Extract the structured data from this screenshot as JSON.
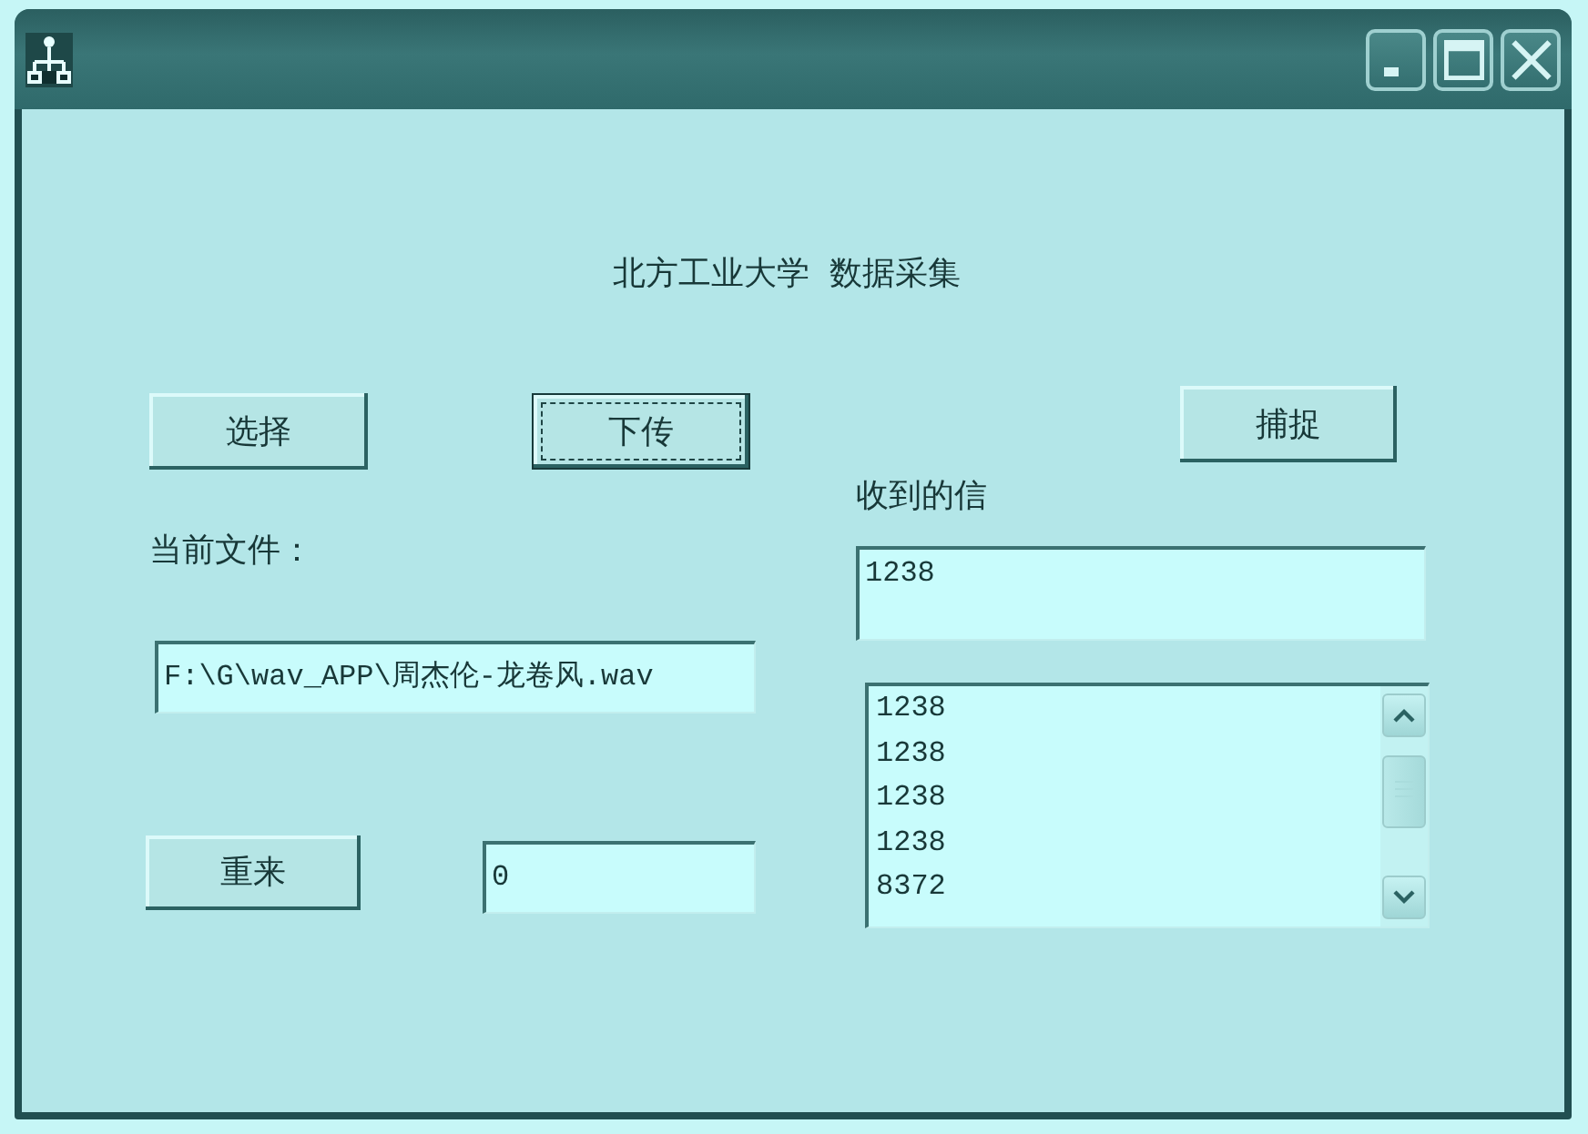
{
  "window": {
    "heading": "北方工业大学  数据采集"
  },
  "file_panel": {
    "select_button": {
      "label": "选择",
      "focused": false
    },
    "download_button": {
      "label": "下传",
      "focused": true
    },
    "file_label": "当前文件：",
    "file_path": {
      "value": "F:\\G\\wav_APP\\周杰伦-龙卷风.wav"
    },
    "reset_button": {
      "label": "重来",
      "focused": false
    },
    "count_field": {
      "value": "0"
    }
  },
  "receive_panel": {
    "capture_button": {
      "label": "捕捉",
      "focused": false
    },
    "received_label": "收到的信",
    "received_field": {
      "value": "1238"
    },
    "received_list": {
      "items": [
        "1238",
        "1238",
        "1238",
        "1238",
        "8372"
      ]
    }
  }
}
